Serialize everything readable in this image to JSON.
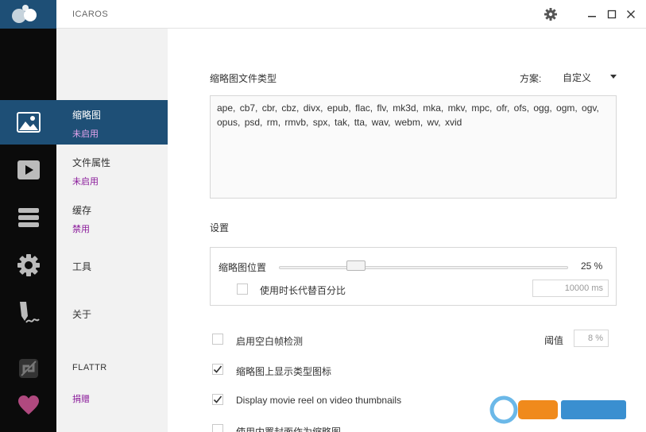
{
  "app": {
    "title": "ICAROS"
  },
  "window": {
    "settings_icon": "gear-icon",
    "minimize_icon": "minimize-icon",
    "maximize_icon": "maximize-icon",
    "close_icon": "close-icon"
  },
  "nav": {
    "items": [
      {
        "id": "thumbnails",
        "icon": "image-icon",
        "title": "缩略图",
        "status": "未启用",
        "active": true
      },
      {
        "id": "properties",
        "icon": "play-icon",
        "title": "文件属性",
        "status": "未启用",
        "active": false
      },
      {
        "id": "cache",
        "icon": "stack-icon",
        "title": "缓存",
        "status": "禁用",
        "active": false
      },
      {
        "id": "tools",
        "icon": "gear-icon",
        "title": "工具",
        "status": "",
        "active": false
      },
      {
        "id": "about",
        "icon": "pen-icon",
        "title": "关于",
        "status": "",
        "active": false
      },
      {
        "id": "flattr",
        "icon": "flattr-icon",
        "title": "FLATTR",
        "status": "",
        "active": false
      },
      {
        "id": "donate",
        "icon": "heart-icon",
        "title": "",
        "status": "捐赠",
        "active": false
      }
    ]
  },
  "main": {
    "filetypes_label": "缩略图文件类型",
    "scheme_label": "方案:",
    "scheme_value": "自定义",
    "filetypes": "ape,  cb7,  cbr,  cbz,  divx,  epub,  flac,  flv,  mk3d,  mka,  mkv,  mpc,  ofr,  ofs,  ogg,  ogm,  ogv,  opus,  psd,  rm,  rmvb,  spx,  tak,  tta,  wav,  webm,  wv,  xvid",
    "settings_label": "设置",
    "position_label": "缩略图位置",
    "position_value": "25 %",
    "position_fraction": 0.25,
    "use_duration_label": "使用时长代替百分比",
    "use_duration_checked": false,
    "duration_value": "10000 ms",
    "blank_frame_label": "启用空白帧检测",
    "blank_frame_checked": false,
    "threshold_label": "阈值",
    "threshold_value": "8 %",
    "show_type_icon_label": "缩略图上显示类型图标",
    "show_type_icon_checked": true,
    "movie_reel_label": "Display movie reel on video thumbnails",
    "movie_reel_checked": true,
    "embedded_cover_label": "使用内置封面作为缩略图",
    "embedded_cover_checked": false
  },
  "colors": {
    "accent": "#1e4f76",
    "status": "#8a1a9a",
    "heart": "#b0497f"
  }
}
